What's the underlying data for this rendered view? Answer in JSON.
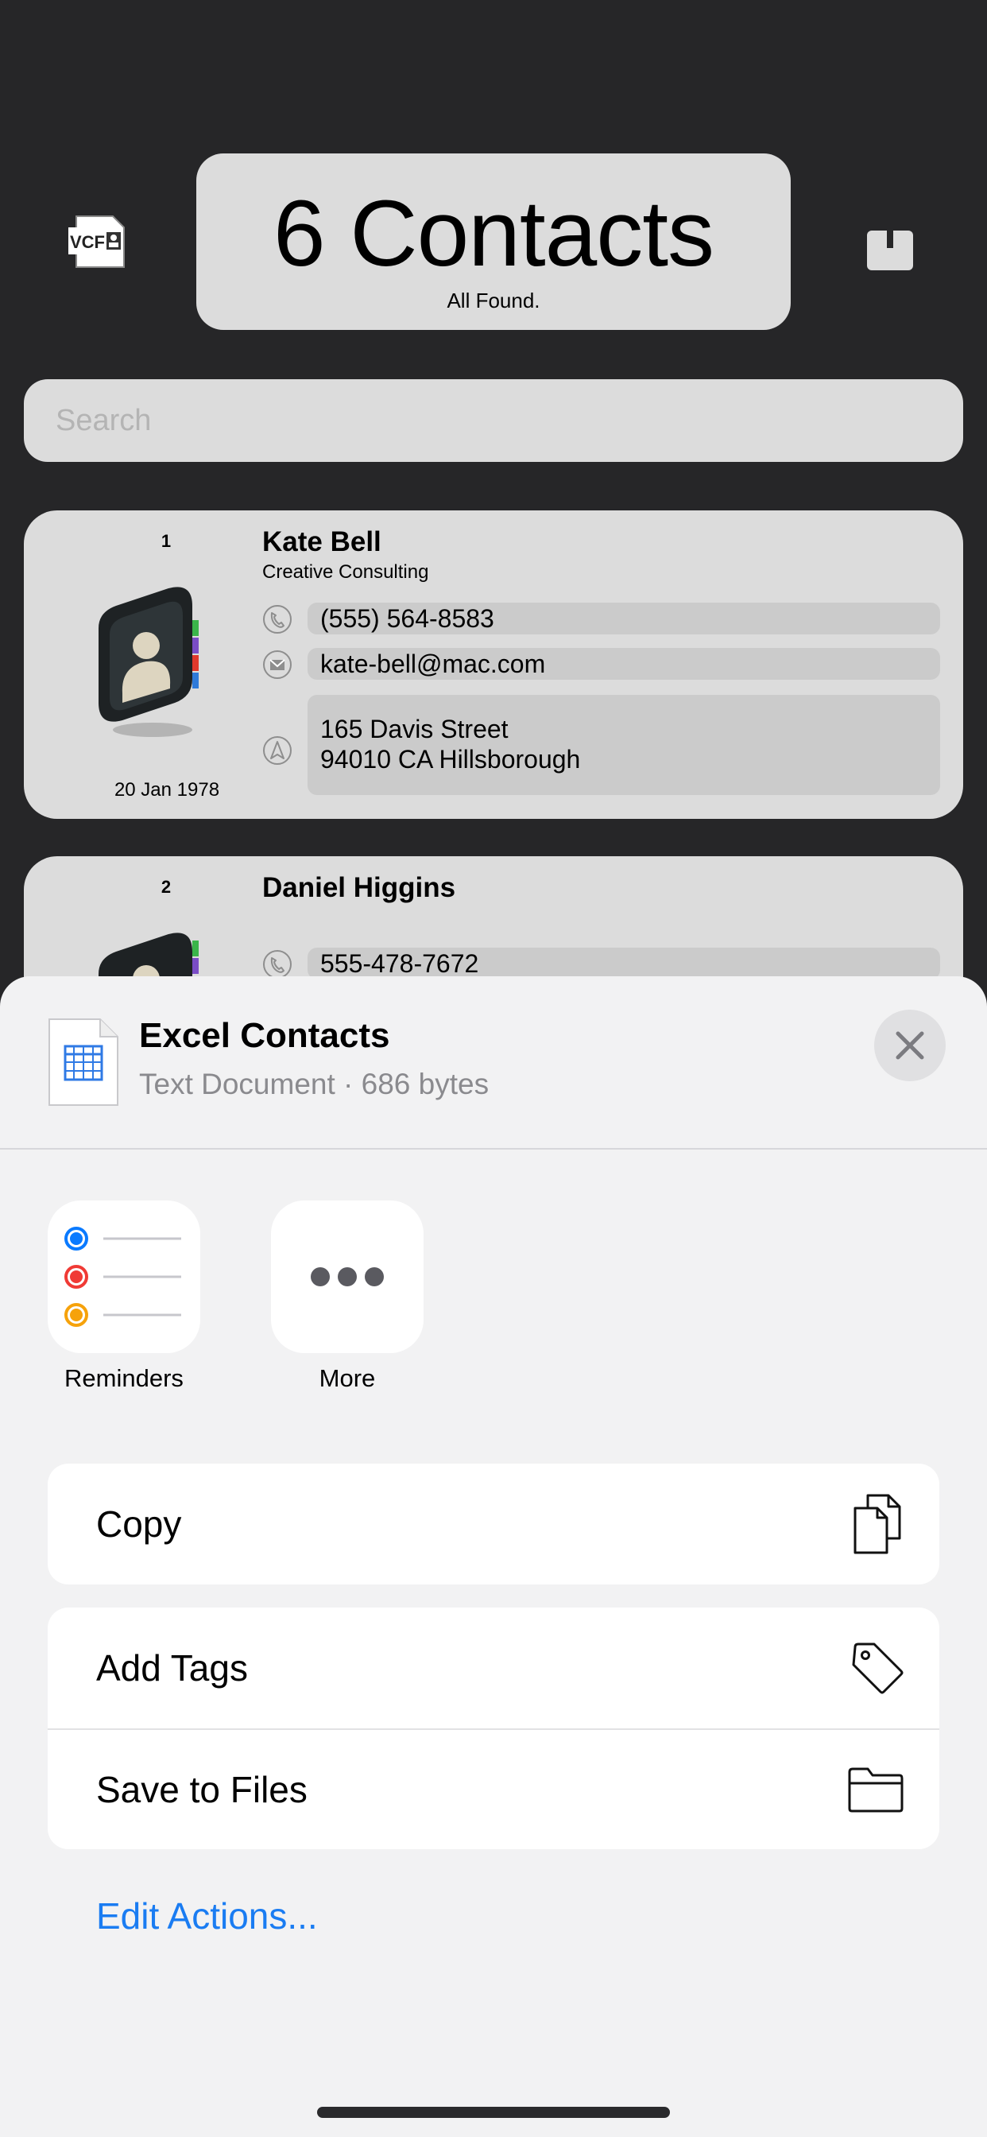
{
  "header": {
    "title": "6 Contacts",
    "subtitle": "All Found.",
    "vcf_badge": "VCF",
    "left_icon": "vcf-file-icon",
    "right_icon": "share-icon"
  },
  "search": {
    "placeholder": "Search",
    "value": ""
  },
  "contacts": [
    {
      "index": "1",
      "name": "Kate Bell",
      "company": "Creative Consulting",
      "phone": "(555) 564-8583",
      "email": "kate-bell@mac.com",
      "address_line1": "165 Davis Street",
      "address_line2": "94010 CA Hillsborough",
      "dob": "20 Jan 1978"
    },
    {
      "index": "2",
      "name": "Daniel Higgins",
      "phone": "555-478-7672"
    }
  ],
  "share_sheet": {
    "file_name": "Excel Contacts",
    "file_meta": "Text Document · 686 bytes",
    "apps": [
      {
        "label": "Reminders",
        "icon": "reminders-icon"
      },
      {
        "label": "More",
        "icon": "more-icon"
      }
    ],
    "actions_group1": [
      {
        "label": "Copy",
        "icon": "copy-icon"
      }
    ],
    "actions_group2": [
      {
        "label": "Add Tags",
        "icon": "tag-icon"
      },
      {
        "label": "Save to Files",
        "icon": "folder-icon"
      }
    ],
    "edit_actions": "Edit Actions..."
  },
  "colors": {
    "background": "#262628",
    "card": "#dcdcdc",
    "sheet": "#f2f2f3",
    "link": "#1a7cf2",
    "reminder_blue": "#0a7aff",
    "reminder_red": "#f03a35",
    "reminder_orange": "#f6a20b"
  }
}
